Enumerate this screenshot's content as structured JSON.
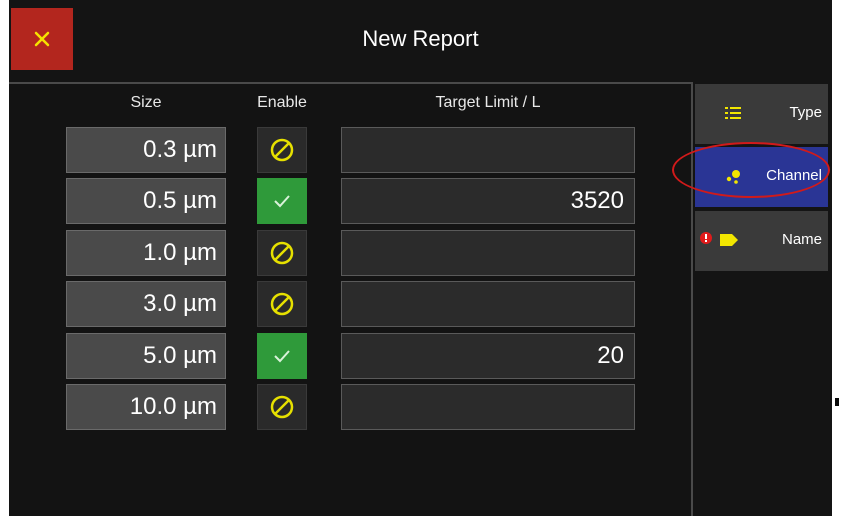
{
  "header": {
    "title": "New Report",
    "close_icon": "close-x-icon",
    "close_color": "#b3261e"
  },
  "table": {
    "headers": {
      "size": "Size",
      "enable": "Enable",
      "limit": "Target Limit / L"
    },
    "rows": [
      {
        "size": "0.3 µm",
        "enabled": false,
        "limit": ""
      },
      {
        "size": "0.5 µm",
        "enabled": true,
        "limit": "3520"
      },
      {
        "size": "1.0 µm",
        "enabled": false,
        "limit": ""
      },
      {
        "size": "3.0 µm",
        "enabled": false,
        "limit": ""
      },
      {
        "size": "5.0 µm",
        "enabled": true,
        "limit": "20"
      },
      {
        "size": "10.0 µm",
        "enabled": false,
        "limit": ""
      }
    ],
    "enabled_icon": "checkmark-icon",
    "disabled_icon": "prohibited-icon",
    "enabled_color": "#2f9a3a",
    "disabled_icon_color": "#e6e000"
  },
  "sidebar": {
    "tabs": [
      {
        "label": "Type",
        "icon": "list-icon",
        "active": false
      },
      {
        "label": "Channel",
        "icon": "channel-dots-icon",
        "active": true
      },
      {
        "label": "Name",
        "icon": "tag-icon",
        "active": false,
        "alert": true
      }
    ],
    "active_color": "#2a3595",
    "icon_color": "#f2e600",
    "alert_color": "#e01b1b"
  }
}
